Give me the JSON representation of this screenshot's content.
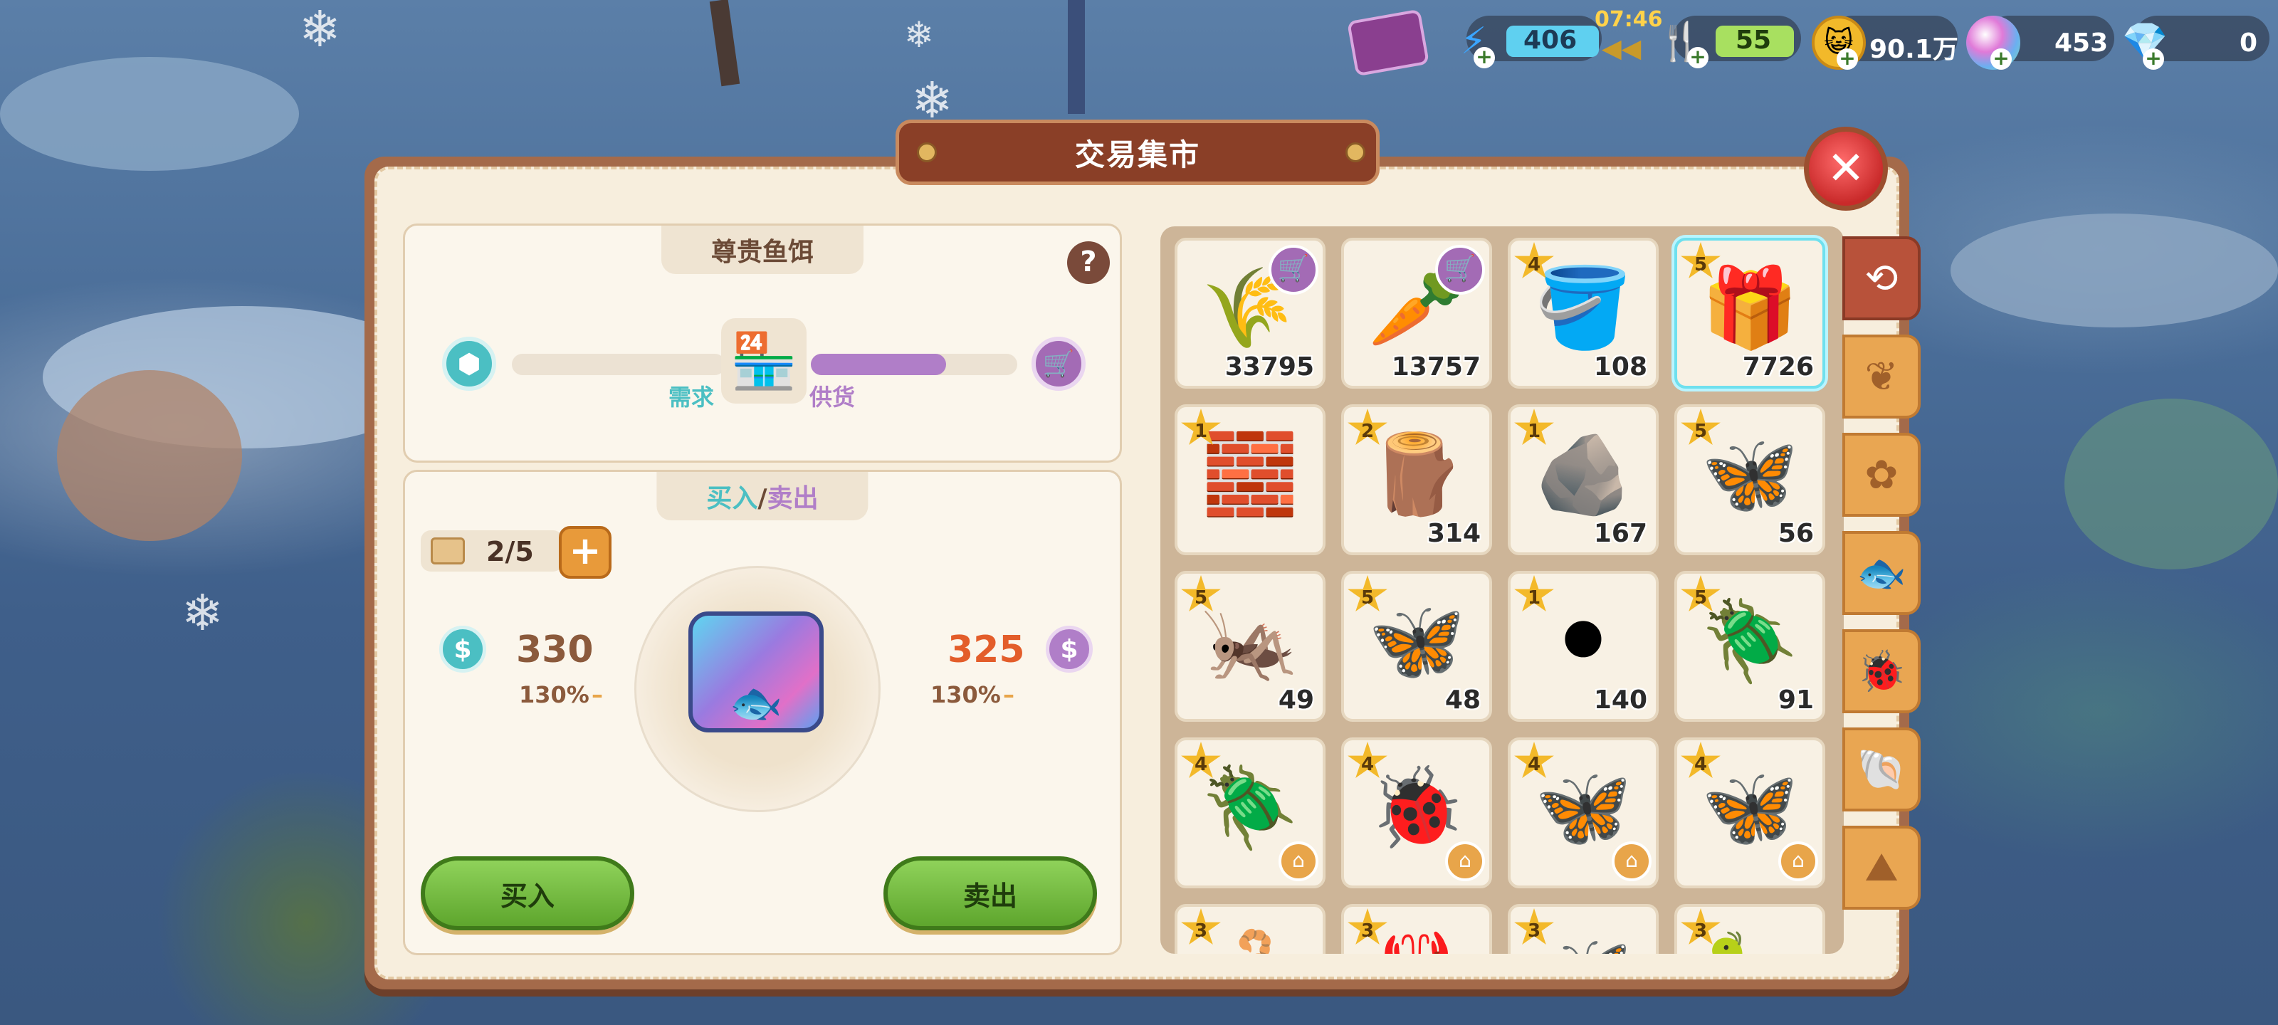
{
  "hud": {
    "energy": "406",
    "timer": "07:46",
    "food": "55",
    "coins": "90.1万",
    "orbs": "453",
    "diamonds": "0"
  },
  "panel": {
    "title": "交易集市"
  },
  "item_info": {
    "name": "尊贵鱼饵",
    "help": "?",
    "demand_label": "需求",
    "supply_label": "供货",
    "demand_level": 0,
    "supply_level": 0.66
  },
  "trade": {
    "tab_buy": "买入",
    "tab_separator": "/",
    "tab_sell": "卖出",
    "quota": "2/5",
    "buy_price": "330",
    "buy_pct": "130%",
    "sell_price": "325",
    "sell_pct": "130%",
    "buy_button": "买入",
    "sell_button": "卖出"
  },
  "inventory": [
    {
      "icon": "wheat-icon",
      "glyph": "🌾",
      "count": "33795",
      "star": "",
      "cart": true
    },
    {
      "icon": "carrot-icon",
      "glyph": "🥕",
      "count": "13757",
      "star": "",
      "cart": true
    },
    {
      "icon": "paint-bucket-icon",
      "glyph": "🪣",
      "count": "108",
      "star": "4",
      "cart": false
    },
    {
      "icon": "premium-bait-box-icon",
      "glyph": "🎁",
      "count": "7726",
      "star": "5",
      "cart": false,
      "selected": true
    },
    {
      "icon": "iron-ingot-icon",
      "glyph": "🧱",
      "count": "",
      "star": "1",
      "cart": false
    },
    {
      "icon": "wood-plank-icon",
      "glyph": "🪵",
      "count": "314",
      "star": "2",
      "cart": false
    },
    {
      "icon": "ore-rock-icon",
      "glyph": "🪨",
      "count": "167",
      "star": "1",
      "cart": false
    },
    {
      "icon": "yellow-butterfly-icon",
      "glyph": "🦋",
      "count": "56",
      "star": "5",
      "cart": false
    },
    {
      "icon": "orchid-mantis-icon",
      "glyph": "🦗",
      "count": "49",
      "star": "5",
      "cart": false
    },
    {
      "icon": "blue-butterfly-icon",
      "glyph": "🦋",
      "count": "48",
      "star": "5",
      "cart": false
    },
    {
      "icon": "coal-icon",
      "glyph": "⚫",
      "count": "140",
      "star": "1",
      "cart": false
    },
    {
      "icon": "stag-beetle-icon",
      "glyph": "🪲",
      "count": "91",
      "star": "5",
      "cart": false
    },
    {
      "icon": "rhino-beetle-icon",
      "glyph": "🪲",
      "count": "",
      "star": "4",
      "cart": false,
      "badge": true
    },
    {
      "icon": "stink-bug-icon",
      "glyph": "🐞",
      "count": "",
      "star": "4",
      "cart": false,
      "badge": true
    },
    {
      "icon": "monarch-butterfly-icon",
      "glyph": "🦋",
      "count": "",
      "star": "4",
      "cart": false,
      "badge": true
    },
    {
      "icon": "luna-moth-icon",
      "glyph": "🦋",
      "count": "",
      "star": "4",
      "cart": false,
      "badge": true
    },
    {
      "icon": "insect-icon",
      "glyph": "🦂",
      "count": "",
      "star": "3",
      "cart": false
    },
    {
      "icon": "insect-icon",
      "glyph": "🦞",
      "count": "",
      "star": "3",
      "cart": false
    },
    {
      "icon": "insect-icon",
      "glyph": "🦋",
      "count": "",
      "star": "3",
      "cart": false
    },
    {
      "icon": "insect-icon",
      "glyph": "🐛",
      "count": "",
      "star": "3",
      "cart": false
    }
  ],
  "side_tabs": [
    {
      "icon": "history-icon",
      "glyph": "⟲",
      "active": true
    },
    {
      "icon": "crops-icon",
      "glyph": "❦",
      "active": false
    },
    {
      "icon": "materials-icon",
      "glyph": "✿",
      "active": false
    },
    {
      "icon": "fish-icon",
      "glyph": "🐟",
      "active": false
    },
    {
      "icon": "bug-icon",
      "glyph": "🐞",
      "active": false
    },
    {
      "icon": "shell-icon",
      "glyph": "🐚",
      "active": false
    },
    {
      "icon": "misc-icon",
      "glyph": "⛰",
      "active": false
    }
  ],
  "colors": {
    "buy_accent": "#4bbfc3",
    "sell_accent": "#b07ec8",
    "sell_price": "#e35d2a",
    "buy_price": "#8b5a3c"
  }
}
